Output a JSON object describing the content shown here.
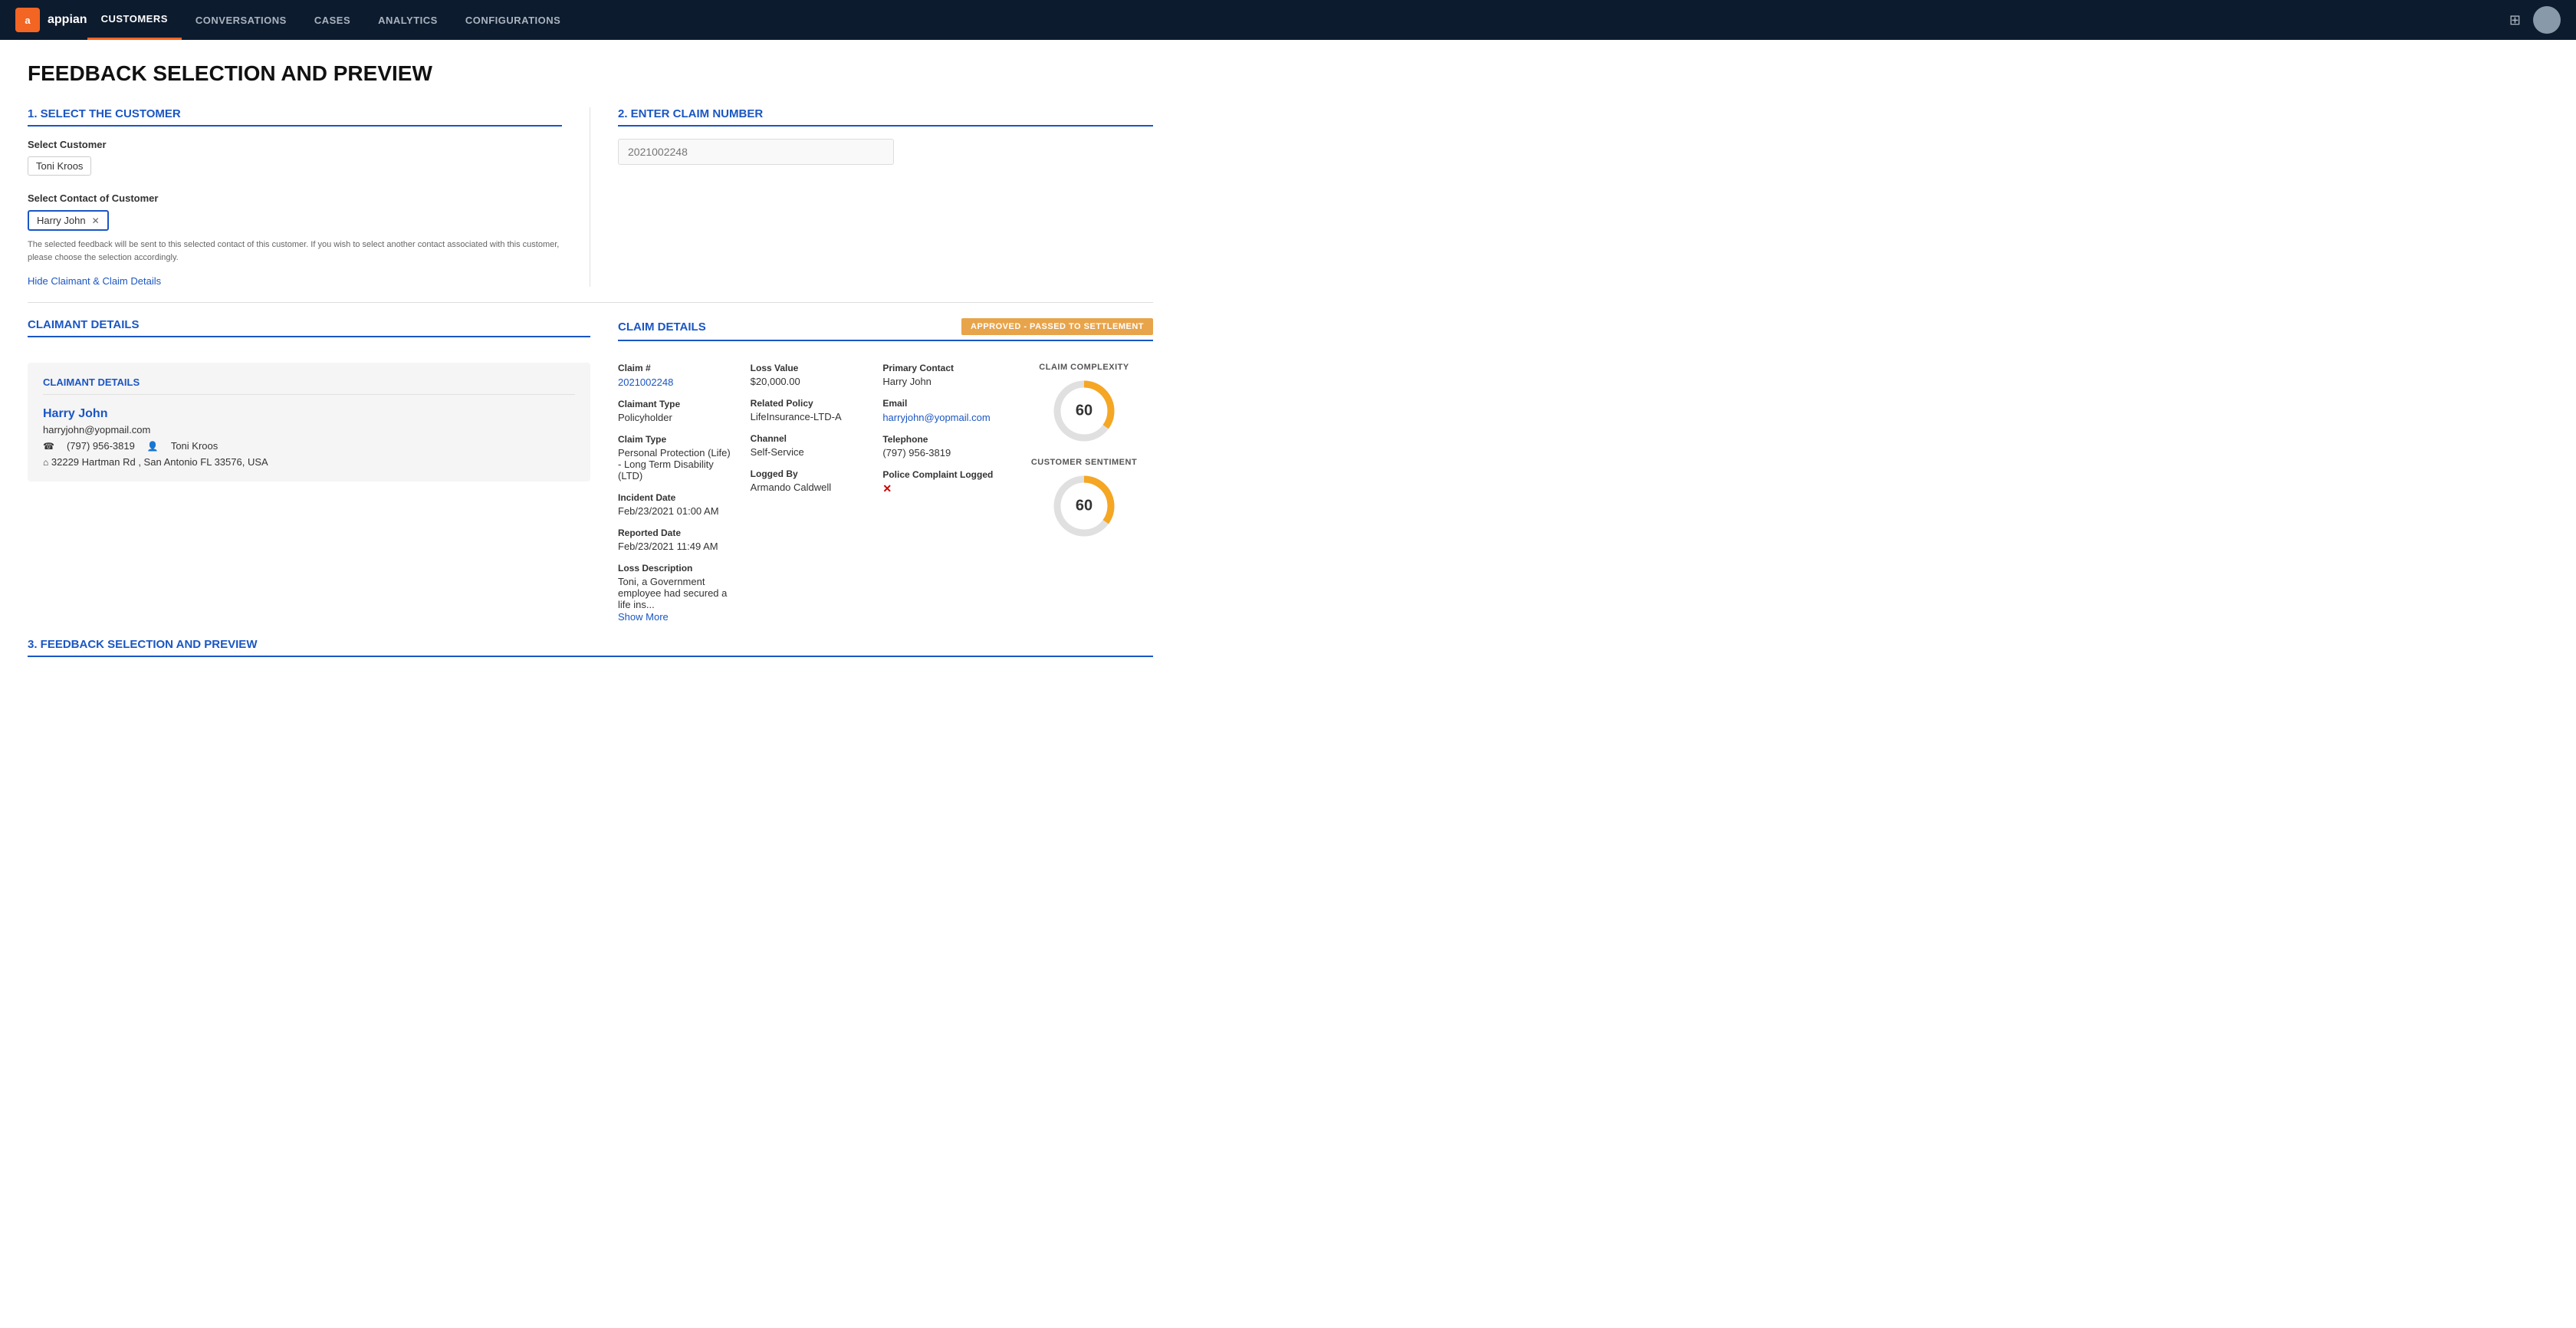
{
  "nav": {
    "logo_text": "appian",
    "links": [
      {
        "label": "CUSTOMERS",
        "active": true
      },
      {
        "label": "CONVERSATIONS",
        "active": false
      },
      {
        "label": "CASES",
        "active": false
      },
      {
        "label": "ANALYTICS",
        "active": false
      },
      {
        "label": "CONFIGURATIONS",
        "active": false
      }
    ]
  },
  "page": {
    "title": "FEEDBACK SELECTION AND PREVIEW"
  },
  "section1": {
    "heading": "1. SELECT THE CUSTOMER",
    "select_customer_label": "Select Customer",
    "selected_customer": "Toni Kroos",
    "select_contact_label": "Select Contact of Customer",
    "selected_contact": "Harry John",
    "hint_text": "The selected feedback will be sent to this selected contact of this customer. If you wish to select another contact associated with this customer, please choose the selection accordingly.",
    "hide_link": "Hide Claimant & Claim Details",
    "claimant_section_heading": "CLAIMANT DETAILS"
  },
  "section2": {
    "heading": "2. ENTER CLAIM NUMBER",
    "claim_number_placeholder": "2021002248"
  },
  "claimant_details": {
    "card_title": "CLAIMANT DETAILS",
    "name": "Harry John",
    "email": "harryjohn@yopmail.com",
    "phone": "(797) 956-3819",
    "contact": "Toni Kroos",
    "address": "32229 Hartman Rd , San Antonio FL 33576, USA"
  },
  "claim_details": {
    "heading": "CLAIM DETAILS",
    "status_badge": "APPROVED - PASSED TO SETTLEMENT",
    "claim_number_label": "Claim #",
    "claim_number": "2021002248",
    "claimant_type_label": "Claimant Type",
    "claimant_type": "Policyholder",
    "claim_type_label": "Claim Type",
    "claim_type": "Personal Protection (Life) - Long Term Disability (LTD)",
    "incident_date_label": "Incident Date",
    "incident_date": "Feb/23/2021 01:00 AM",
    "reported_date_label": "Reported Date",
    "reported_date": "Feb/23/2021 11:49 AM",
    "loss_description_label": "Loss Description",
    "loss_description": "Toni, a Government employee had secured a life ins...",
    "show_more": "Show More",
    "loss_value_label": "Loss Value",
    "loss_value": "$20,000.00",
    "related_policy_label": "Related Policy",
    "related_policy": "LifeInsurance-LTD-A",
    "channel_label": "Channel",
    "channel": "Self-Service",
    "logged_by_label": "Logged By",
    "logged_by": "Armando Caldwell",
    "primary_contact_label": "Primary Contact",
    "primary_contact": "Harry John",
    "email_label": "Email",
    "email_value": "harryjohn@yopmail.com",
    "telephone_label": "Telephone",
    "telephone": "(797) 956-3819",
    "police_complaint_label": "Police Complaint Logged",
    "claim_complexity_label": "CLAIM COMPLEXITY",
    "claim_complexity_value": 60,
    "customer_sentiment_label": "CUSTOMER SENTIMENT",
    "customer_sentiment_value": 60
  },
  "section3": {
    "heading": "3. FEEDBACK SELECTION AND PREVIEW"
  }
}
